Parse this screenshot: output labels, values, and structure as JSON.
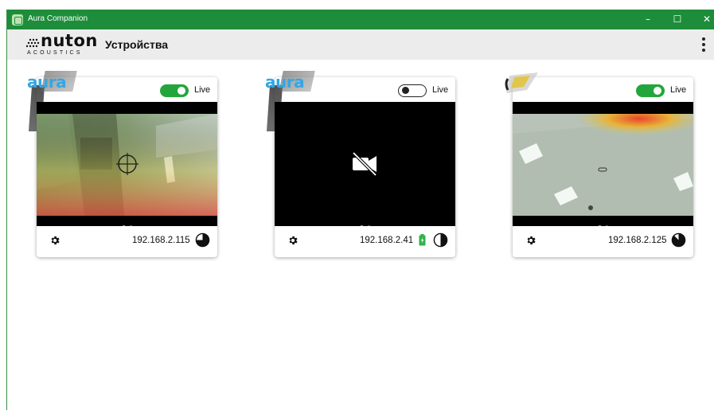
{
  "window": {
    "title": "Aura Companion",
    "controls": {
      "minimize": "–",
      "maximize": "☐",
      "close": "✕"
    }
  },
  "appbar": {
    "logo_word": "nuton",
    "logo_sub": "ACOUSTICS",
    "page_title": "Устройства"
  },
  "devices": [
    {
      "logo": "aura",
      "live_label": "Live",
      "live_on": true,
      "ip": "192.168.2.115",
      "battery_visible": false,
      "pie_fraction": 0.75,
      "view": "heatmap-room"
    },
    {
      "logo": "aura",
      "live_label": "Live",
      "live_on": false,
      "ip": "192.168.2.41",
      "battery_visible": true,
      "pie_fraction": 0.5,
      "view": "no-video"
    },
    {
      "logo": "",
      "live_label": "Live",
      "live_on": true,
      "ip": "192.168.2.125",
      "battery_visible": false,
      "pie_fraction": 0.875,
      "view": "heatmap-ceiling"
    }
  ],
  "colors": {
    "titlebar": "#1e8d3b",
    "toggle_on": "#22a63b",
    "aura_blue": "#34a7e3",
    "battery": "#2fb34a",
    "dot_active": "#7cc77e"
  },
  "icons": {
    "menu": "more-vertical-icon",
    "settings": "gear-icon",
    "no_video": "video-off-icon",
    "battery": "battery-icon",
    "status": "pie-status-icon"
  }
}
